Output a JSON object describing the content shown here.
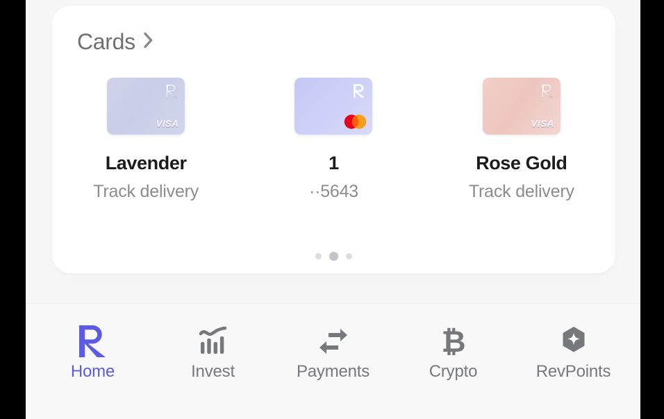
{
  "theme": {
    "accent": "#5b5be6",
    "screen_bg": "#f7f7f8",
    "panel_bg": "#ffffff",
    "tabbar_bg": "#f8f8f9",
    "muted_text": "#8b8c90",
    "title_text": "#6f7073",
    "name_text": "#1c1c1e",
    "letterbox": "#000000",
    "dot_inactive": "#dcdde1",
    "dot_active": "#c2c4ca"
  },
  "panel": {
    "header": {
      "title": "Cards",
      "chevron_icon": "chevron-right-icon"
    },
    "cards": [
      {
        "name": "Lavender",
        "subtitle": "Track delivery",
        "network": "visa",
        "network_label": "VISA",
        "brand_icon": "revolut-r-icon",
        "art_style": "lavender",
        "art_colors": [
          "#cfd2e9",
          "#c9cde7",
          "#d2d5ec"
        ]
      },
      {
        "name": "1",
        "subtitle": "··5643",
        "network": "mastercard",
        "network_label": "",
        "brand_icon": "revolut-r-icon",
        "art_style": "plus",
        "art_colors": [
          "#c5c8f5",
          "#cfd1f7",
          "#d8d9fa"
        ]
      },
      {
        "name": "Rose Gold",
        "subtitle": "Track delivery",
        "network": "visa",
        "network_label": "VISA",
        "brand_icon": "revolut-r-icon",
        "art_style": "rosegold",
        "art_colors": [
          "#f2cfc9",
          "#edc6c0",
          "#f4d6d1"
        ]
      }
    ],
    "pager": {
      "total": 3,
      "active_index": 1
    }
  },
  "tabbar": {
    "items": [
      {
        "label": "Home",
        "icon": "revolut-r-icon",
        "active": true
      },
      {
        "label": "Invest",
        "icon": "bar-chart-icon",
        "active": false
      },
      {
        "label": "Payments",
        "icon": "transfer-arrows-icon",
        "active": false
      },
      {
        "label": "Crypto",
        "icon": "bitcoin-icon",
        "active": false
      },
      {
        "label": "RevPoints",
        "icon": "hexagon-sparkle-icon",
        "active": false
      }
    ]
  }
}
